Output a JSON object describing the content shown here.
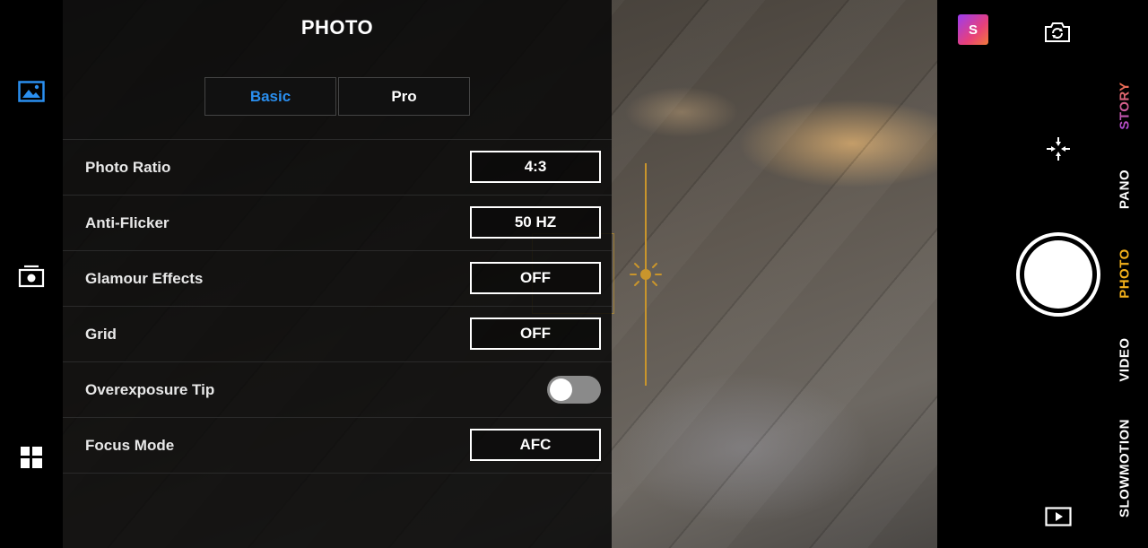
{
  "panel": {
    "title": "PHOTO",
    "tabs": [
      {
        "label": "Basic",
        "active": true
      },
      {
        "label": "Pro",
        "active": false
      }
    ],
    "settings": [
      {
        "label": "Photo Ratio",
        "value": "4:3"
      },
      {
        "label": "Anti-Flicker",
        "value": "50 HZ"
      },
      {
        "label": "Glamour Effects",
        "value": "OFF"
      },
      {
        "label": "Grid",
        "value": "OFF"
      },
      {
        "label": "Overexposure Tip",
        "toggle": false
      },
      {
        "label": "Focus Mode",
        "value": "AFC"
      }
    ]
  },
  "left_rail": {
    "icons": [
      "gallery-icon",
      "switch-camera-icon",
      "grid-menu-icon"
    ]
  },
  "right_rail": {
    "profile_initial": "S",
    "modes": [
      {
        "label": "STORY",
        "active": false
      },
      {
        "label": "PANO",
        "active": false
      },
      {
        "label": "PHOTO",
        "active": true
      },
      {
        "label": "VIDEO",
        "active": false
      },
      {
        "label": "SLOWMOTION",
        "active": false
      }
    ]
  },
  "colors": {
    "accent_blue": "#2a8ff0",
    "active_mode": "#f5b21b",
    "exposure": "#c9952c"
  }
}
